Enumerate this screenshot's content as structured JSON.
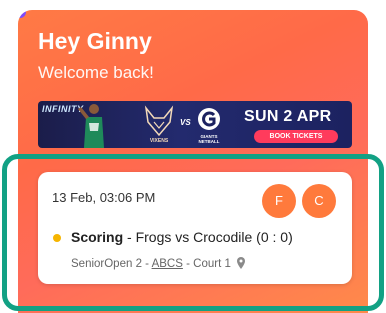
{
  "header": {
    "greeting": "Hey Ginny",
    "subtitle": "Welcome back!"
  },
  "banner": {
    "brand_text": "INFINITY",
    "home_team": "VIXENS",
    "vs_text": "VS",
    "away_team": "GIANTS NETBALL",
    "date": "SUN 2 APR",
    "cta_label": "BOOK TICKETS"
  },
  "match_card": {
    "datetime": "13 Feb, 03:06 PM",
    "avatars": [
      "F",
      "C"
    ],
    "status": "Scoring",
    "separator": " - ",
    "match_title": "Frogs vs Crocodile (0 : 0)",
    "competition": "SeniorOpen 2",
    "venue": "ABCS",
    "court": "Court 1",
    "status_color": "#f6b500"
  },
  "colors": {
    "accent": "#ff7a3c",
    "highlight_border": "#12a184"
  }
}
